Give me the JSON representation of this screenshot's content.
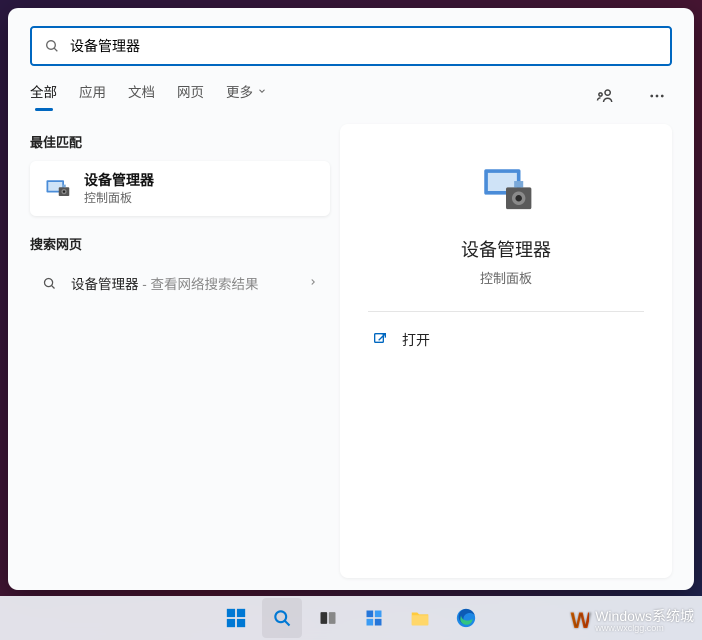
{
  "search": {
    "query": "设备管理器"
  },
  "tabs": {
    "all": "全部",
    "apps": "应用",
    "docs": "文档",
    "web": "网页",
    "more": "更多"
  },
  "sections": {
    "bestMatch": "最佳匹配",
    "searchWeb": "搜索网页"
  },
  "bestResult": {
    "title": "设备管理器",
    "subtitle": "控制面板"
  },
  "webResult": {
    "term": "设备管理器",
    "suffix": " - 查看网络搜索结果"
  },
  "detail": {
    "title": "设备管理器",
    "subtitle": "控制面板",
    "openLabel": "打开"
  },
  "watermark": {
    "brand": "Windows系统城",
    "url": "www.wxclgg.com"
  }
}
